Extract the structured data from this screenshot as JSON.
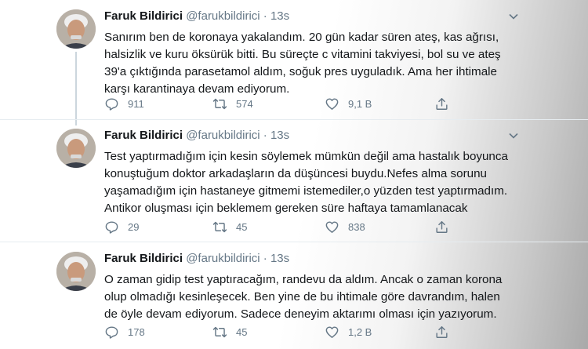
{
  "tweets": [
    {
      "name": "Faruk Bildirici",
      "handle": "@farukbildirici",
      "dot": "·",
      "time": "13s",
      "text": "Sanırım ben de koronaya yakalandım. 20 gün kadar süren ateş, kas ağrısı,\nhalsizlik ve kuru öksürük bitti. Bu süreçte c vitamini takviyesi, bol su ve ateş\n39'a çıktığında parasetamol aldım, soğuk pres uyguladık.  Ama her ihtimale\nkarşı karantinaya devam ediyorum.",
      "replies": "911",
      "retweets": "574",
      "likes": "9,1 B"
    },
    {
      "name": "Faruk Bildirici",
      "handle": "@farukbildirici",
      "dot": "·",
      "time": "13s",
      "text": "Test yaptırmadığım için kesin söylemek mümkün değil ama hastalık boyunca\nkonuştuğum doktor arkadaşların da düşüncesi buydu.Nefes alma sorunu\nyaşamadığım için hastaneye gitmemi istemediler,o yüzden test yaptırmadım.\nAntikor oluşması için beklemem gereken süre haftaya tamamlanacak",
      "replies": "29",
      "retweets": "45",
      "likes": "838"
    },
    {
      "name": "Faruk Bildirici",
      "handle": "@farukbildirici",
      "dot": "·",
      "time": "13s",
      "text": "O zaman gidip test yaptıracağım, randevu da aldım. Ancak o zaman korona\nolup olmadığı kesinleşecek.  Ben yine de bu ihtimale göre davrandım, halen\nde öyle devam ediyorum. Sadece deneyim aktarımı olması için yazıyorum.",
      "replies": "178",
      "retweets": "45",
      "likes": "1,2 B"
    }
  ],
  "icons": {
    "reply": "reply-icon",
    "retweet": "retweet-icon",
    "like": "heart-icon",
    "share": "share-icon",
    "more": "chevron-down-icon"
  },
  "colors": {
    "text": "#14171a",
    "muted": "#657786",
    "divider": "#e6ecf0",
    "thread_line": "#ccd6dd"
  }
}
